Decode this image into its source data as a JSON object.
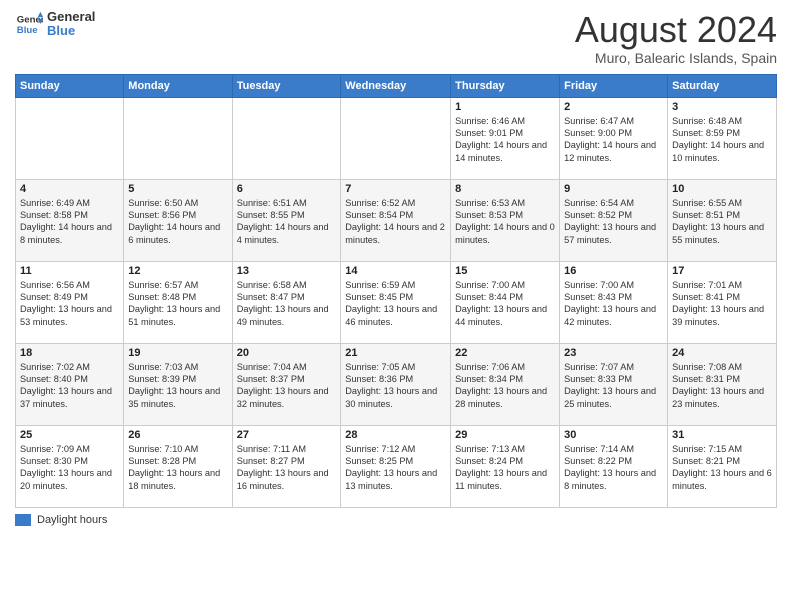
{
  "header": {
    "logo_line1": "General",
    "logo_line2": "Blue",
    "title": "August 2024",
    "subtitle": "Muro, Balearic Islands, Spain"
  },
  "days_of_week": [
    "Sunday",
    "Monday",
    "Tuesday",
    "Wednesday",
    "Thursday",
    "Friday",
    "Saturday"
  ],
  "weeks": [
    [
      {
        "day": "",
        "info": ""
      },
      {
        "day": "",
        "info": ""
      },
      {
        "day": "",
        "info": ""
      },
      {
        "day": "",
        "info": ""
      },
      {
        "day": "1",
        "info": "Sunrise: 6:46 AM\nSunset: 9:01 PM\nDaylight: 14 hours\nand 14 minutes."
      },
      {
        "day": "2",
        "info": "Sunrise: 6:47 AM\nSunset: 9:00 PM\nDaylight: 14 hours\nand 12 minutes."
      },
      {
        "day": "3",
        "info": "Sunrise: 6:48 AM\nSunset: 8:59 PM\nDaylight: 14 hours\nand 10 minutes."
      }
    ],
    [
      {
        "day": "4",
        "info": "Sunrise: 6:49 AM\nSunset: 8:58 PM\nDaylight: 14 hours\nand 8 minutes."
      },
      {
        "day": "5",
        "info": "Sunrise: 6:50 AM\nSunset: 8:56 PM\nDaylight: 14 hours\nand 6 minutes."
      },
      {
        "day": "6",
        "info": "Sunrise: 6:51 AM\nSunset: 8:55 PM\nDaylight: 14 hours\nand 4 minutes."
      },
      {
        "day": "7",
        "info": "Sunrise: 6:52 AM\nSunset: 8:54 PM\nDaylight: 14 hours\nand 2 minutes."
      },
      {
        "day": "8",
        "info": "Sunrise: 6:53 AM\nSunset: 8:53 PM\nDaylight: 14 hours\nand 0 minutes."
      },
      {
        "day": "9",
        "info": "Sunrise: 6:54 AM\nSunset: 8:52 PM\nDaylight: 13 hours\nand 57 minutes."
      },
      {
        "day": "10",
        "info": "Sunrise: 6:55 AM\nSunset: 8:51 PM\nDaylight: 13 hours\nand 55 minutes."
      }
    ],
    [
      {
        "day": "11",
        "info": "Sunrise: 6:56 AM\nSunset: 8:49 PM\nDaylight: 13 hours\nand 53 minutes."
      },
      {
        "day": "12",
        "info": "Sunrise: 6:57 AM\nSunset: 8:48 PM\nDaylight: 13 hours\nand 51 minutes."
      },
      {
        "day": "13",
        "info": "Sunrise: 6:58 AM\nSunset: 8:47 PM\nDaylight: 13 hours\nand 49 minutes."
      },
      {
        "day": "14",
        "info": "Sunrise: 6:59 AM\nSunset: 8:45 PM\nDaylight: 13 hours\nand 46 minutes."
      },
      {
        "day": "15",
        "info": "Sunrise: 7:00 AM\nSunset: 8:44 PM\nDaylight: 13 hours\nand 44 minutes."
      },
      {
        "day": "16",
        "info": "Sunrise: 7:00 AM\nSunset: 8:43 PM\nDaylight: 13 hours\nand 42 minutes."
      },
      {
        "day": "17",
        "info": "Sunrise: 7:01 AM\nSunset: 8:41 PM\nDaylight: 13 hours\nand 39 minutes."
      }
    ],
    [
      {
        "day": "18",
        "info": "Sunrise: 7:02 AM\nSunset: 8:40 PM\nDaylight: 13 hours\nand 37 minutes."
      },
      {
        "day": "19",
        "info": "Sunrise: 7:03 AM\nSunset: 8:39 PM\nDaylight: 13 hours\nand 35 minutes."
      },
      {
        "day": "20",
        "info": "Sunrise: 7:04 AM\nSunset: 8:37 PM\nDaylight: 13 hours\nand 32 minutes."
      },
      {
        "day": "21",
        "info": "Sunrise: 7:05 AM\nSunset: 8:36 PM\nDaylight: 13 hours\nand 30 minutes."
      },
      {
        "day": "22",
        "info": "Sunrise: 7:06 AM\nSunset: 8:34 PM\nDaylight: 13 hours\nand 28 minutes."
      },
      {
        "day": "23",
        "info": "Sunrise: 7:07 AM\nSunset: 8:33 PM\nDaylight: 13 hours\nand 25 minutes."
      },
      {
        "day": "24",
        "info": "Sunrise: 7:08 AM\nSunset: 8:31 PM\nDaylight: 13 hours\nand 23 minutes."
      }
    ],
    [
      {
        "day": "25",
        "info": "Sunrise: 7:09 AM\nSunset: 8:30 PM\nDaylight: 13 hours\nand 20 minutes."
      },
      {
        "day": "26",
        "info": "Sunrise: 7:10 AM\nSunset: 8:28 PM\nDaylight: 13 hours\nand 18 minutes."
      },
      {
        "day": "27",
        "info": "Sunrise: 7:11 AM\nSunset: 8:27 PM\nDaylight: 13 hours\nand 16 minutes."
      },
      {
        "day": "28",
        "info": "Sunrise: 7:12 AM\nSunset: 8:25 PM\nDaylight: 13 hours\nand 13 minutes."
      },
      {
        "day": "29",
        "info": "Sunrise: 7:13 AM\nSunset: 8:24 PM\nDaylight: 13 hours\nand 11 minutes."
      },
      {
        "day": "30",
        "info": "Sunrise: 7:14 AM\nSunset: 8:22 PM\nDaylight: 13 hours\nand 8 minutes."
      },
      {
        "day": "31",
        "info": "Sunrise: 7:15 AM\nSunset: 8:21 PM\nDaylight: 13 hours\nand 6 minutes."
      }
    ]
  ],
  "legend": {
    "label": "Daylight hours"
  }
}
